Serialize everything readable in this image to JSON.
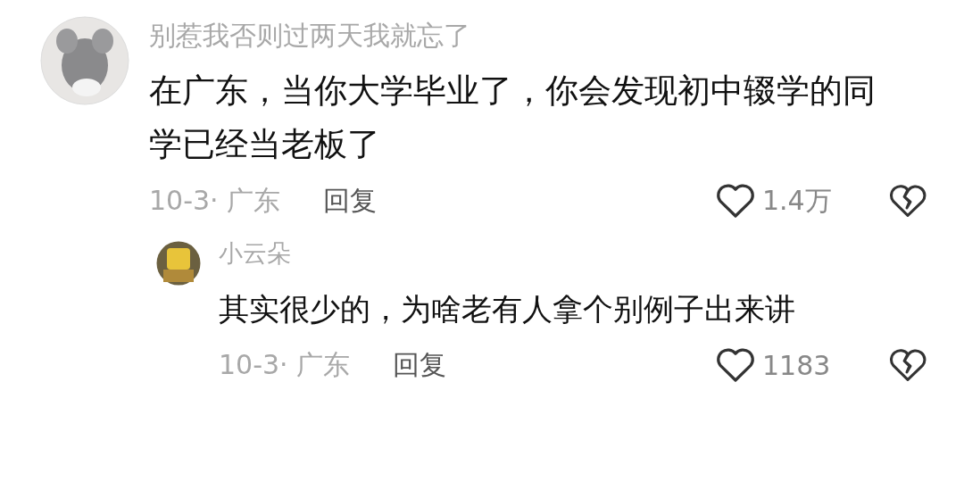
{
  "comments": [
    {
      "username": "别惹我否则过两天我就忘了",
      "text": "在广东，当你大学毕业了，你会发现初中辍学的同学已经当老板了",
      "date": "10-3· 广东",
      "reply_label": "回复",
      "likes": "1.4万",
      "replies": [
        {
          "username": "小云朵",
          "text": "其实很少的，为啥老有人拿个别例子出来讲",
          "date": "10-3· 广东",
          "reply_label": "回复",
          "likes": "1183"
        }
      ]
    }
  ]
}
